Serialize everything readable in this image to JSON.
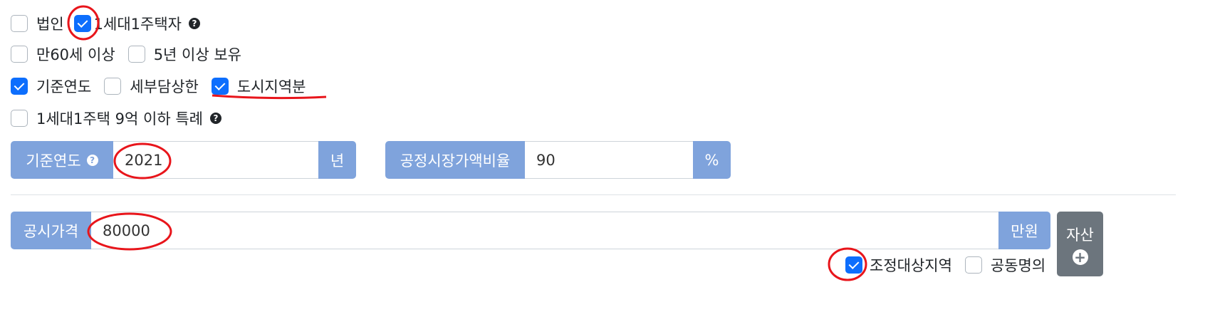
{
  "options_row1": [
    {
      "label": "법인",
      "checked": false
    },
    {
      "label": "1세대1주택자",
      "checked": true
    }
  ],
  "options_row2": [
    {
      "label": "만60세 이상",
      "checked": false
    },
    {
      "label": "5년 이상 보유",
      "checked": false
    }
  ],
  "options_row3": [
    {
      "label": "기준연도",
      "checked": true
    },
    {
      "label": "세부담상한",
      "checked": false
    },
    {
      "label": "도시지역분",
      "checked": true
    }
  ],
  "options_row4": [
    {
      "label": "1세대1주택 9억 이하 특례",
      "checked": false
    }
  ],
  "base_year": {
    "label": "기준연도",
    "value": "2021",
    "unit": "년"
  },
  "market_ratio": {
    "label": "공정시장가액비율",
    "value": "90",
    "unit": "%"
  },
  "announced_price": {
    "label": "공시가격",
    "value": "80000",
    "unit": "만원"
  },
  "asset_button": {
    "label": "자산"
  },
  "bottom_options": [
    {
      "label": "조정대상지역",
      "checked": true
    },
    {
      "label": "공동명의",
      "checked": false
    }
  ],
  "icons": {
    "help": "question-circle-icon",
    "add": "plus-circle-icon"
  },
  "colors": {
    "addon": "#7fa3dc",
    "checkbox_checked": "#0d6efd",
    "asset_button": "#6c757d",
    "annotation": "#e8151b"
  }
}
